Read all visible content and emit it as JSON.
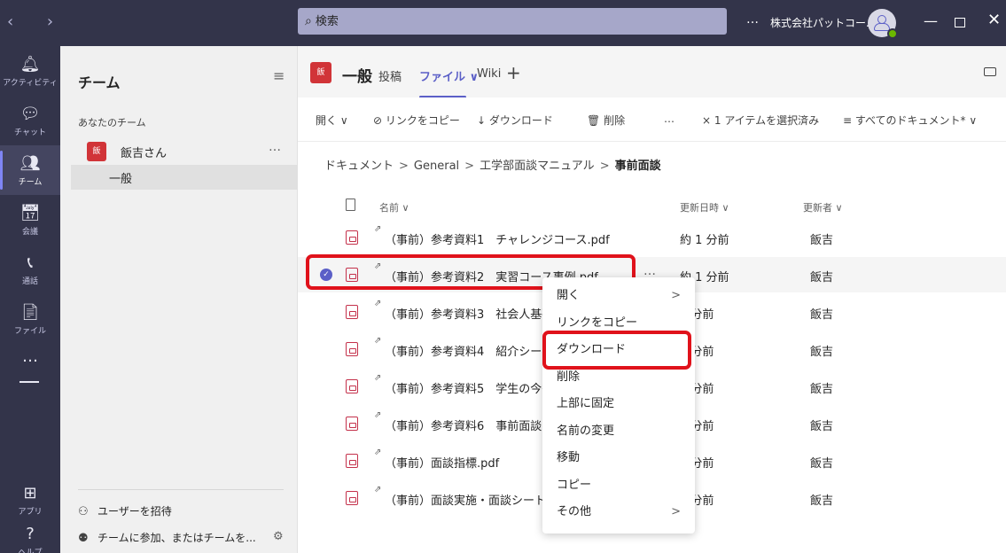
{
  "titlebar": {
    "search_placeholder": "検索",
    "more": "…",
    "org_name": "株式会社パットコー..."
  },
  "rail": [
    {
      "label": "アクティビティ",
      "icon": "bell-icon"
    },
    {
      "label": "チャット",
      "icon": "chat-icon"
    },
    {
      "label": "チーム",
      "icon": "teams-icon"
    },
    {
      "label": "会議",
      "icon": "calendar-icon"
    },
    {
      "label": "通話",
      "icon": "phone-icon"
    },
    {
      "label": "ファイル",
      "icon": "file-icon"
    }
  ],
  "rail_more": "…",
  "rail_apps": "アプリ",
  "rail_help": "ヘルプ",
  "leftpane": {
    "title": "チーム",
    "section": "あなたのチーム",
    "team_avatar": "飯",
    "team_name": "飯吉さん",
    "team_more": "…",
    "channel": "一般",
    "invite": "ユーザーを招待",
    "join": "チームに参加、またはチームを..."
  },
  "header": {
    "avatar": "飯",
    "channel_title": "一般",
    "tabs": {
      "posts": "投稿",
      "files": "ファイル ∨",
      "wiki": "Wiki",
      "add": "+"
    }
  },
  "toolbar": {
    "open": "開く ∨",
    "copy_link": "リンクをコピー",
    "download": "ダウンロード",
    "delete": "削除",
    "more": "…",
    "selected": "× 1 アイテムを選択済み",
    "view": "≡ すべてのドキュメント* ∨"
  },
  "breadcrumb": {
    "items": [
      "ドキュメント",
      "General",
      "工学部面談マニュアル"
    ],
    "current": "事前面談",
    "separator": ">"
  },
  "columns": {
    "name": "名前 ∨",
    "modified": "更新日時 ∨",
    "modified_by": "更新者 ∨"
  },
  "files": [
    {
      "name": "（事前）参考資料1　チャレンジコース.pdf",
      "modified": "約 1 分前",
      "by": "飯吉",
      "selected": false
    },
    {
      "name": "（事前）参考資料2　実習コース事例.pdf",
      "modified": "約 1 分前",
      "by": "飯吉",
      "selected": true
    },
    {
      "name": "（事前）参考資料3　社会人基礎",
      "modified": "1 分前",
      "by": "飯吉",
      "selected": false
    },
    {
      "name": "（事前）参考資料4　紹介シート",
      "modified": "1 分前",
      "by": "飯吉",
      "selected": false
    },
    {
      "name": "（事前）参考資料5　学生の今後",
      "modified": "1 分前",
      "by": "飯吉",
      "selected": false
    },
    {
      "name": "（事前）参考資料6　事前面談",
      "modified": "1 分前",
      "by": "飯吉",
      "selected": false
    },
    {
      "name": "（事前）面談指標.pdf",
      "modified": "1 分前",
      "by": "飯吉",
      "selected": false
    },
    {
      "name": "（事前）面談実施・面談シート記入",
      "modified": "1 分前",
      "by": "飯吉",
      "selected": false
    }
  ],
  "row_more": "…",
  "context_menu": [
    {
      "label": "開く",
      "submenu": true
    },
    {
      "label": "リンクをコピー",
      "submenu": false
    },
    {
      "label": "ダウンロード",
      "submenu": false
    },
    {
      "label": "削除",
      "submenu": false
    },
    {
      "label": "上部に固定",
      "submenu": false
    },
    {
      "label": "名前の変更",
      "submenu": false
    },
    {
      "label": "移動",
      "submenu": false
    },
    {
      "label": "コピー",
      "submenu": false
    },
    {
      "label": "その他",
      "submenu": true
    }
  ],
  "colors": {
    "titlebar": "#33344a",
    "accent": "#5b5fc7",
    "highlight": "#e0121b",
    "pdf": "#c4314b"
  }
}
